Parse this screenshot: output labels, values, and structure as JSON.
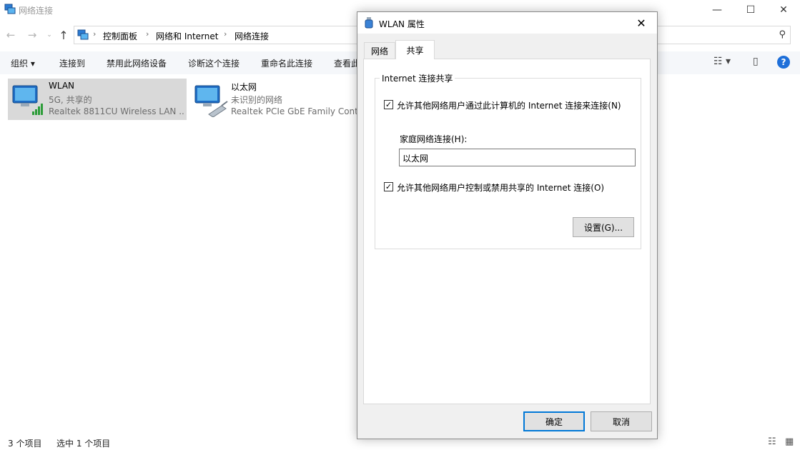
{
  "window": {
    "title": "网络连接",
    "minimize_glyph": "—",
    "maximize_glyph": "☐",
    "close_glyph": "✕"
  },
  "nav": {
    "back_glyph": "←",
    "forward_glyph": "→",
    "dropdown_glyph": "⌄",
    "up_glyph": "↑",
    "breadcrumbs": [
      "控制面板",
      "网络和 Internet",
      "网络连接"
    ],
    "separator": "›",
    "search_glyph": "⚲"
  },
  "toolbar": {
    "items": [
      "组织 ▾",
      "连接到",
      "禁用此网络设备",
      "诊断这个连接",
      "重命名此连接",
      "查看此"
    ],
    "view_glyph": "☷ ▾",
    "pane_glyph": "▯",
    "help_glyph": "?"
  },
  "connections": [
    {
      "name": "WLAN",
      "status": "5G, 共享的",
      "device": "Realtek 8811CU Wireless LAN ...",
      "icon": "wifi-adapter-icon"
    },
    {
      "name": "以太网",
      "status": "未识别的网络",
      "device": "Realtek PCIe GbE Family Controller",
      "icon": "ethernet-adapter-icon"
    }
  ],
  "statusbar": {
    "count": "3 个项目",
    "selected": "选中 1 个项目"
  },
  "dialog": {
    "title": "WLAN 属性",
    "close_glyph": "✕",
    "tabs": [
      "网络",
      "共享"
    ],
    "active_tab": "共享",
    "group_title": "Internet 连接共享",
    "allow_connect": {
      "label": "允许其他网络用户通过此计算机的 Internet 连接来连接(N)",
      "checked": true,
      "mark": "✓"
    },
    "home_network_label": "家庭网络连接(H):",
    "home_network_value": "以太网",
    "allow_control": {
      "label": "允许其他网络用户控制或禁用共享的 Internet 连接(O)",
      "checked": true,
      "mark": "✓"
    },
    "settings_button": "设置(G)...",
    "ok_button": "确定",
    "cancel_button": "取消"
  },
  "colors": {
    "selected_item_bg": "#d9d9d9",
    "toolbar_bg": "#f5f7fa",
    "dialog_bg": "#f0f0f0",
    "default_button_border": "#0078d7",
    "help_icon_bg": "#1e6fd9",
    "secondary_text": "#6d6d6d"
  }
}
